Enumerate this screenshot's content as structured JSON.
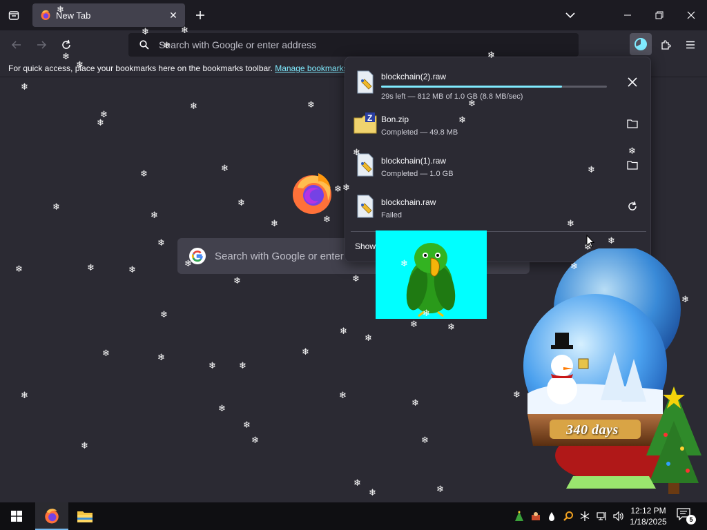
{
  "tabs": [
    {
      "title": "New Tab",
      "icon": "firefox-icon"
    }
  ],
  "urlbar": {
    "placeholder": "Search with Google or enter address"
  },
  "bookmarks_bar": {
    "message": "For quick access, place your bookmarks here on the bookmarks toolbar.",
    "link": "Manage bookmarks"
  },
  "content": {
    "search_placeholder": "Search with Google or enter address"
  },
  "downloads": {
    "items": [
      {
        "name": "blockchain(2).raw",
        "status": "29s left — 812 MB of 1.0 GB (8.8 MB/sec)",
        "progress": 0.8,
        "action": "cancel-icon",
        "file_icon": "raw-file-icon"
      },
      {
        "name": "Bon.zip",
        "status": "Completed — 49.8 MB",
        "action": "folder-icon",
        "file_icon": "zip-file-icon"
      },
      {
        "name": "blockchain(1).raw",
        "status": "Completed — 1.0 GB",
        "action": "folder-icon",
        "file_icon": "raw-file-icon"
      },
      {
        "name": "blockchain.raw",
        "status": "Failed",
        "action": "retry-icon",
        "file_icon": "raw-file-icon"
      }
    ],
    "show_all": "Show"
  },
  "snow_globe": {
    "label": "340 days"
  },
  "taskbar": {
    "time": "12:12 PM",
    "date": "1/18/2025",
    "notification_count": "5"
  },
  "colors": {
    "accent": "#80ebff",
    "background": "#2b2a33",
    "chrome": "#1c1b22",
    "parrot_bg": "#00ffff"
  }
}
